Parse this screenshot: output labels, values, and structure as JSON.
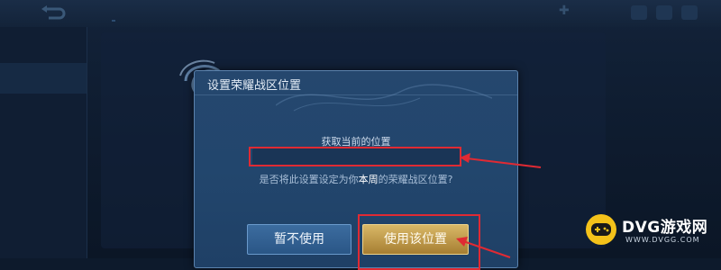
{
  "dialog": {
    "title": "设置荣耀战区位置",
    "location_label": "获取当前的位置",
    "location_value": "",
    "question_prefix": "是否将此设置设定为你",
    "question_emphasis": "本周",
    "question_suffix": "的荣耀战区位置?",
    "cancel_label": "暂不使用",
    "confirm_label": "使用该位置"
  },
  "brand": {
    "name": "DVG游戏网",
    "url": "WWW.DVGG.COM"
  },
  "colors": {
    "highlight": "#e02a33",
    "brand_yellow": "#f4c21a"
  }
}
